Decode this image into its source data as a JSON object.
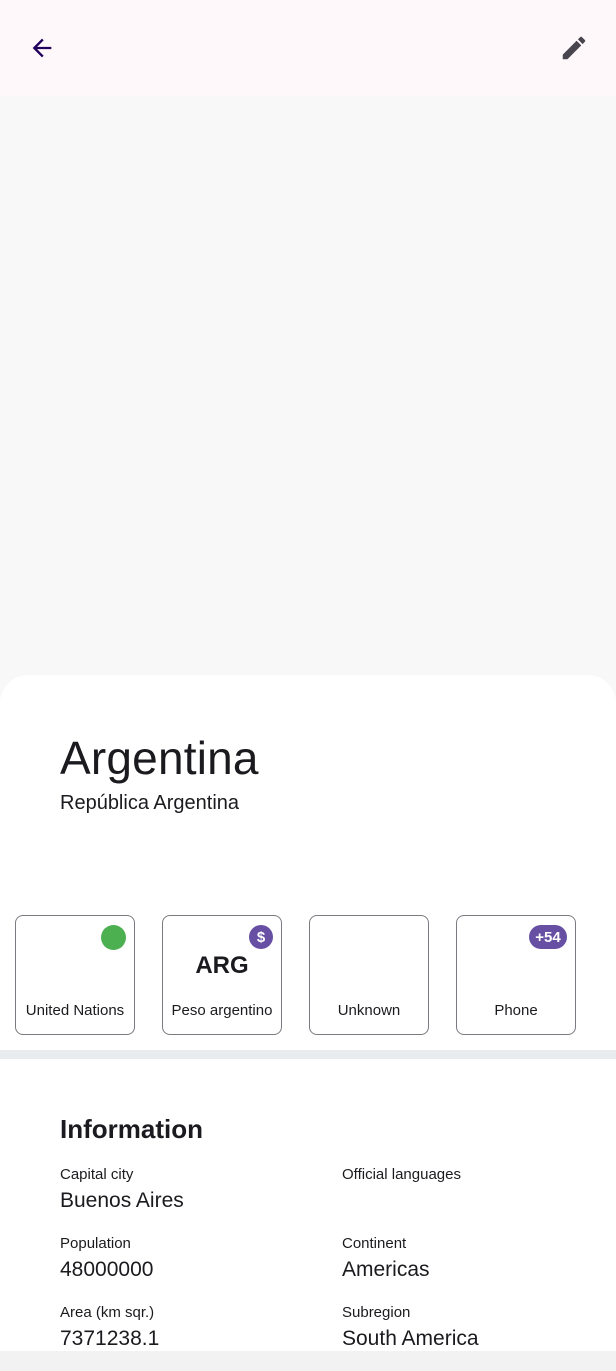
{
  "toolbar": {
    "back_icon": "arrow-left-icon",
    "edit_icon": "pencil-icon",
    "icon_color": "#21005d",
    "edit_color": "#49454f"
  },
  "country": {
    "name": "Argentina",
    "official_name": "República Argentina"
  },
  "cards": [
    {
      "label": "United Nations",
      "indicator": "green-dot",
      "color": "#4caf50"
    },
    {
      "label": "Peso argentino",
      "center": "ARG",
      "badge": "$",
      "color": "#6750a4"
    },
    {
      "label": "Unknown"
    },
    {
      "label": "Phone",
      "badge": "+54",
      "color": "#6750a4"
    }
  ],
  "information": {
    "title": "Information",
    "capital_label": "Capital city",
    "capital_value": "Buenos Aires",
    "languages_label": "Official languages",
    "languages_value": "",
    "population_label": "Population",
    "population_value": "48000000",
    "continent_label": "Continent",
    "continent_value": "Americas",
    "area_label": "Area (km sqr.)",
    "area_value": "7371238.1",
    "subregion_label": "Subregion",
    "subregion_value": "South America"
  }
}
